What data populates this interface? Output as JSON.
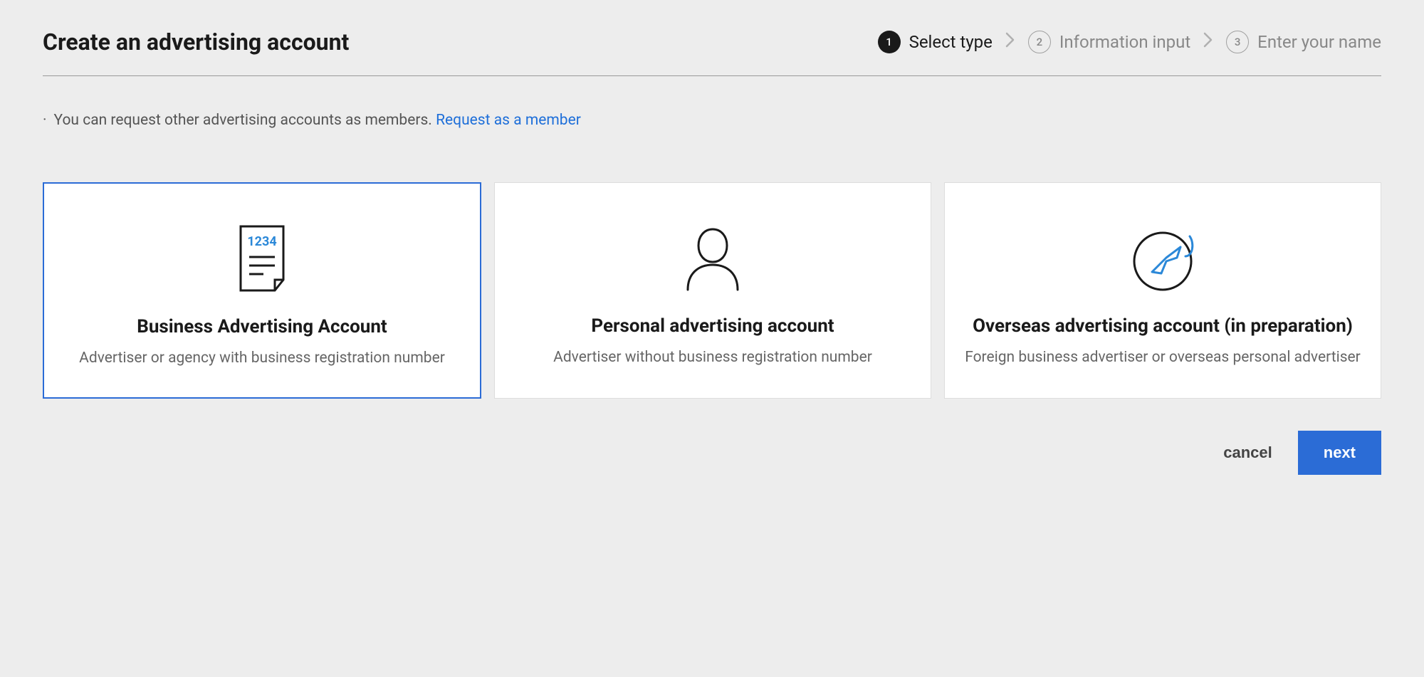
{
  "page_title": "Create an advertising account",
  "stepper": {
    "steps": [
      {
        "num": "1",
        "label": "Select type",
        "active": true
      },
      {
        "num": "2",
        "label": "Information input",
        "active": false
      },
      {
        "num": "3",
        "label": "Enter your name",
        "active": false
      }
    ]
  },
  "info": {
    "text": "You can request other advertising accounts as members.",
    "link_text": "Request as a member"
  },
  "cards": [
    {
      "title": "Business Advertising Account",
      "desc": "Advertiser or agency with business registration number",
      "selected": true
    },
    {
      "title": "Personal advertising account",
      "desc": "Advertiser without business registration number",
      "selected": false
    },
    {
      "title": "Overseas advertising account (in preparation)",
      "desc": "Foreign business advertiser or overseas personal advertiser",
      "selected": false
    }
  ],
  "actions": {
    "cancel": "cancel",
    "next": "next"
  },
  "icons": {
    "doc_number": "1234"
  }
}
